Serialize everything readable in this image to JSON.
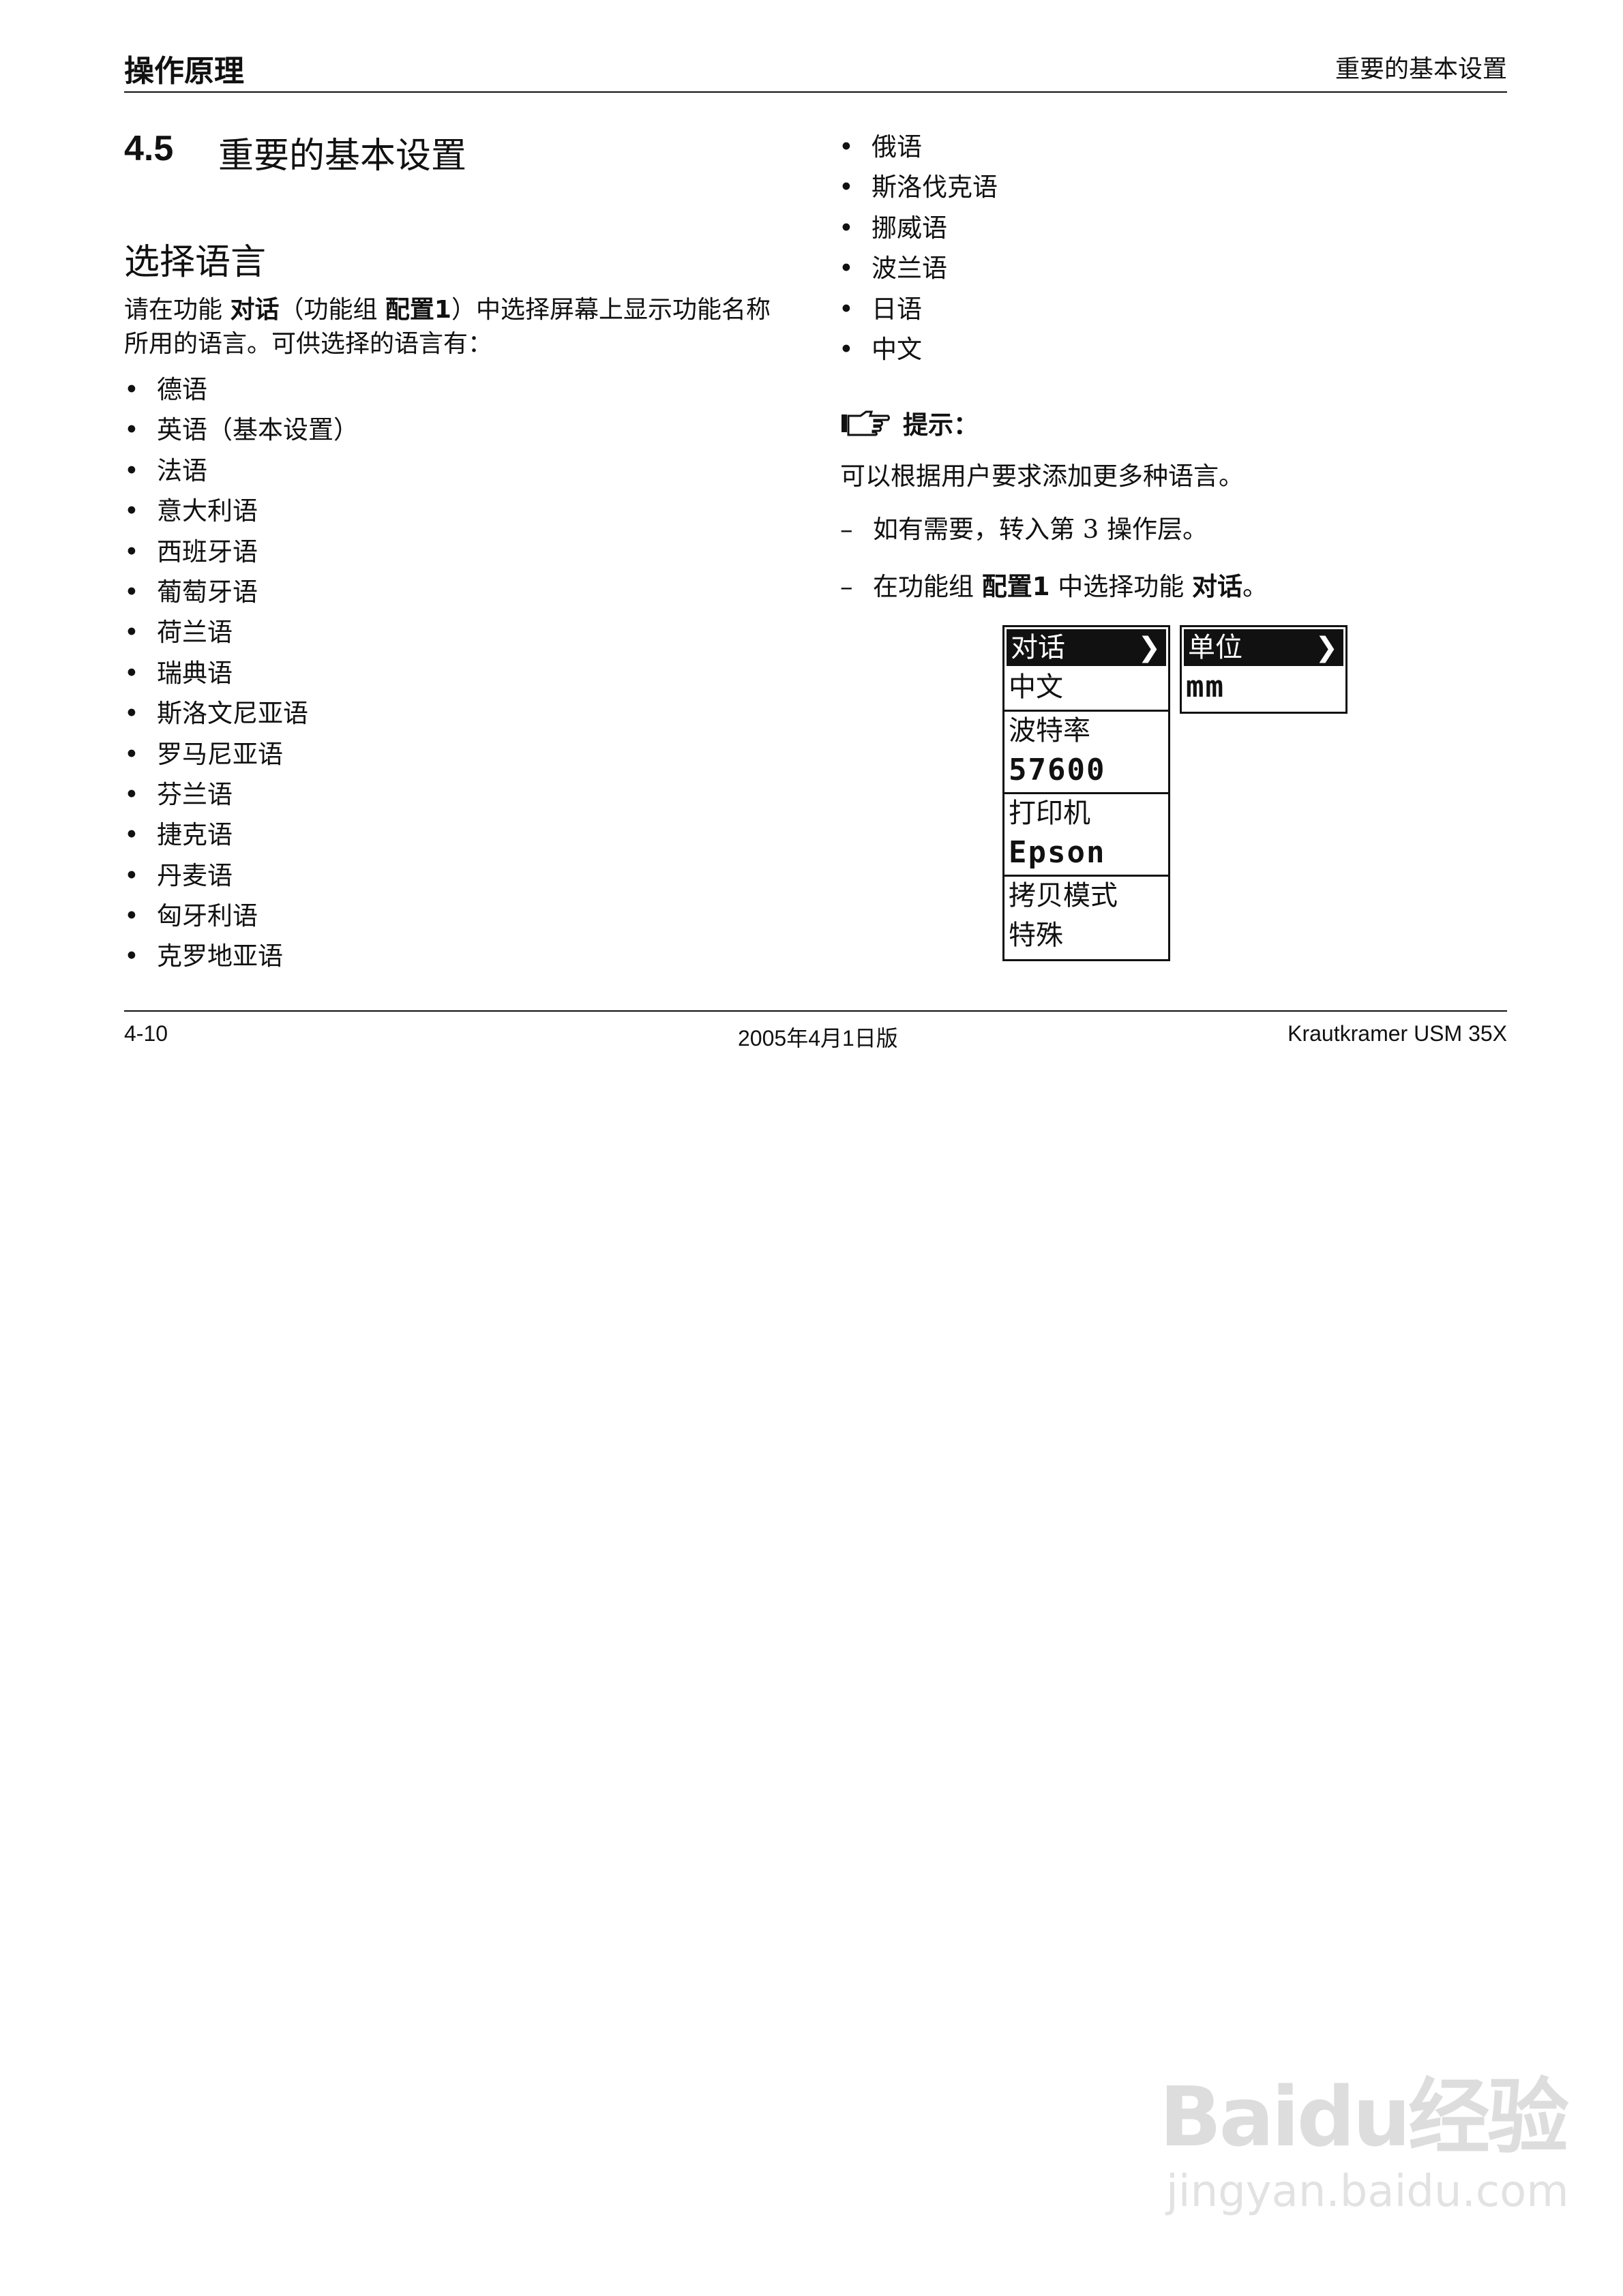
{
  "header": {
    "left": "操作原理",
    "right": "重要的基本设置"
  },
  "section": {
    "number": "4.5",
    "title": "重要的基本设置"
  },
  "subsection": {
    "title": "选择语言"
  },
  "intro": {
    "p1": "请在功能 ",
    "func": "对话",
    "p2": "（功能组 ",
    "group": "配置1",
    "p3": "）中选择屏幕上显示功能名称所用的语言。可供选择的语言有："
  },
  "bullet_char": "•",
  "languages_left": [
    "德语",
    "英语（基本设置）",
    "法语",
    "意大利语",
    "西班牙语",
    "葡萄牙语",
    "荷兰语",
    "瑞典语",
    "斯洛文尼亚语",
    "罗马尼亚语",
    "芬兰语",
    "捷克语",
    "丹麦语",
    "匈牙利语",
    "克罗地亚语"
  ],
  "languages_right": [
    "俄语",
    "斯洛伐克语",
    "挪威语",
    "波兰语",
    "日语",
    "中文"
  ],
  "tip": {
    "label": "提示：",
    "text": "可以根据用户要求添加更多种语言。"
  },
  "steps": {
    "dash": "–",
    "s1": "如有需要，转入第 3 操作层。",
    "s2_a": "在功能组 ",
    "s2_group": "配置1",
    "s2_b": " 中选择功能 ",
    "s2_func": "对话",
    "s2_c": "。"
  },
  "lcd_left": [
    {
      "label": "对话",
      "value": "中文",
      "highlighted": true
    },
    {
      "label": "波特率",
      "value": "57600"
    },
    {
      "label": "打印机",
      "value": "Epson"
    },
    {
      "label": "拷贝模式",
      "value": "特殊"
    }
  ],
  "lcd_right": [
    {
      "label": "单位",
      "value": "mm",
      "highlighted": true
    }
  ],
  "chevron": "❯",
  "footer": {
    "left": "4-10",
    "center": "2005年4月1日版",
    "right": "Krautkramer  USM 35X"
  },
  "watermark": {
    "logo": "Baidu经验",
    "url": "jingyan.baidu.com"
  }
}
